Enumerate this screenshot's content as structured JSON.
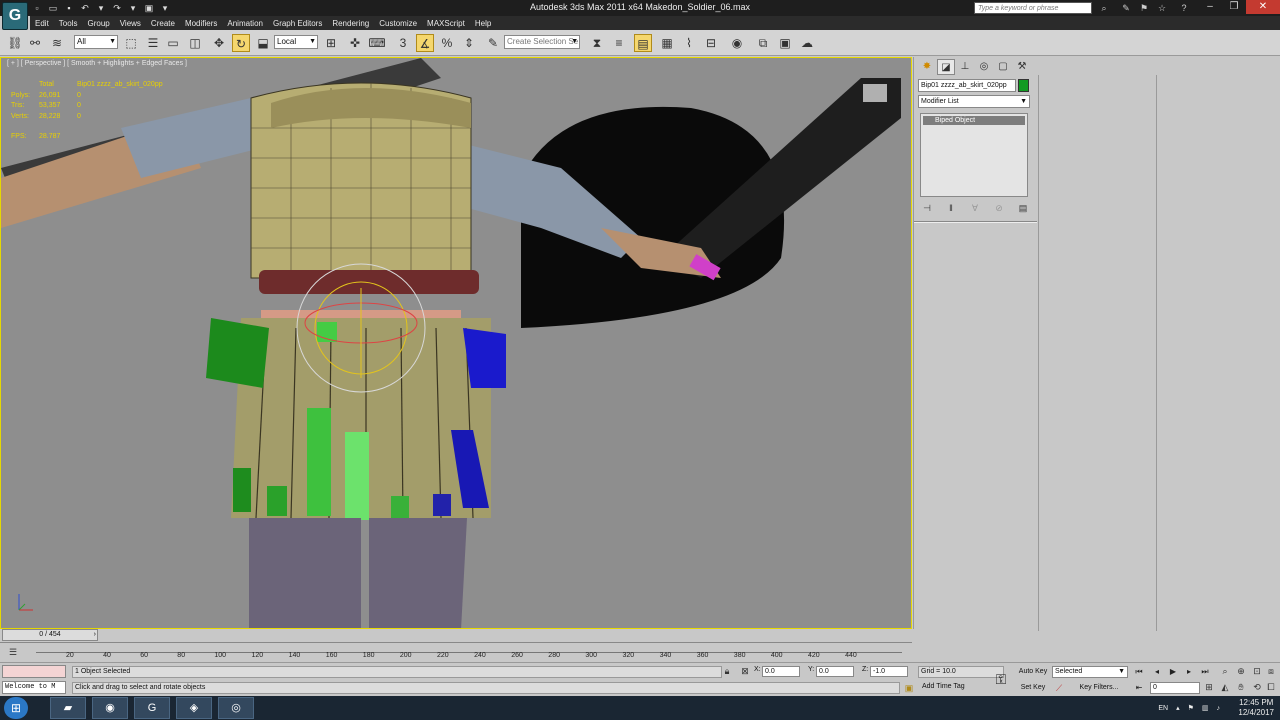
{
  "window": {
    "title": "Autodesk 3ds Max  2011 x64      Makedon_Soldier_06.max",
    "help_search_placeholder": "Type a keyword or phrase",
    "logo_glyph": "G"
  },
  "menubar": {
    "items": [
      "Edit",
      "Tools",
      "Group",
      "Views",
      "Create",
      "Modifiers",
      "Animation",
      "Graph Editors",
      "Rendering",
      "Customize",
      "MAXScript",
      "Help"
    ]
  },
  "toolbar": {
    "selection_filter": "All",
    "reference_coord": "Local",
    "named_selection_placeholder": "Create Selection Se"
  },
  "viewport": {
    "label": "[ + ] [ Perspective ] [ Smooth + Highlights + Edged Faces ]",
    "stats": {
      "header": {
        "label": "",
        "total": "Total",
        "selected": "Bip01 zzzz_ab_skirt_020pp"
      },
      "rows": [
        {
          "label": "Polys:",
          "total": "26,091",
          "selected": "0"
        },
        {
          "label": "Tris:",
          "total": "53,357",
          "selected": "0"
        },
        {
          "label": "Verts:",
          "total": "28,228",
          "selected": "0"
        }
      ],
      "fps_label": "FPS:",
      "fps_value": "28.787"
    }
  },
  "command_panel": {
    "object_name": "Bip01 zzzz_ab_skirt_020pp",
    "object_color": "#119a22",
    "modifier_list_label": "Modifier List",
    "stack_item": "Biped Object"
  },
  "timeline": {
    "frame_display": "0 / 454",
    "ticks": [
      "20",
      "40",
      "60",
      "80",
      "100",
      "120",
      "140",
      "160",
      "180",
      "200",
      "220",
      "240",
      "260",
      "280",
      "300",
      "320",
      "340",
      "360",
      "380",
      "400",
      "420",
      "440"
    ]
  },
  "status": {
    "listener_prompt": "Welcome to M",
    "selection_info": "1 Object Selected",
    "prompt_text": "Click and drag to select and rotate objects",
    "x_label": "X:",
    "x_value": "0.0",
    "y_label": "Y:",
    "y_value": "0.0",
    "z_label": "Z:",
    "z_value": "-1.0",
    "grid": "Grid = 10.0",
    "add_time_tag": "Add Time Tag",
    "auto_key": "Auto Key",
    "set_key": "Set Key",
    "auto_key_mode": "Selected",
    "key_filters": "Key Filters...",
    "current_frame": "0"
  },
  "taskbar": {
    "language": "EN",
    "time": "12:45 PM",
    "date": "12/4/2017"
  }
}
